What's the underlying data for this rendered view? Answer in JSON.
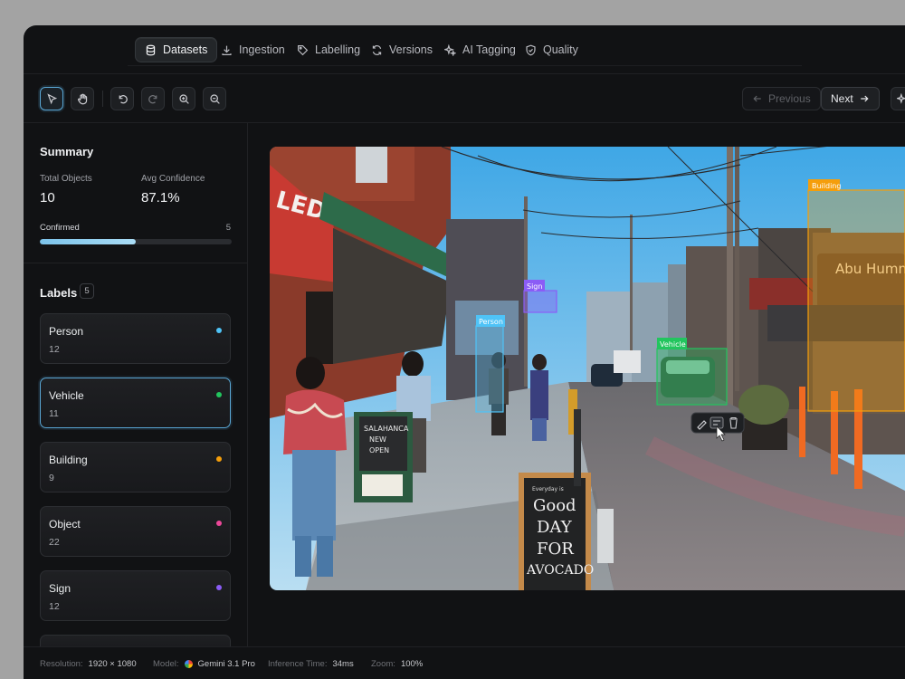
{
  "nav": {
    "tabs": [
      {
        "label": "Datasets",
        "icon": "database-icon",
        "active": true
      },
      {
        "label": "Ingestion",
        "icon": "download-icon"
      },
      {
        "label": "Labelling",
        "icon": "tag-icon"
      },
      {
        "label": "Versions",
        "icon": "refresh-icon"
      },
      {
        "label": "AI Tagging",
        "icon": "sparkle-icon"
      },
      {
        "label": "Quality",
        "icon": "shield-icon"
      }
    ]
  },
  "toolbar": {
    "previous_label": "Previous",
    "next_label": "Next"
  },
  "summary": {
    "title": "Summary",
    "total_objects_label": "Total Objects",
    "total_objects": "10",
    "avg_confidence_label": "Avg Confidence",
    "avg_confidence": "87.1%",
    "confirmed_label": "Confirmed",
    "confirmed_count": "5",
    "confirmed_fraction": 0.5
  },
  "labels": {
    "title": "Labels",
    "count": "5",
    "items": [
      {
        "name": "Person",
        "count": "12",
        "color": "#4fc3f7"
      },
      {
        "name": "Vehicle",
        "count": "11",
        "color": "#22c55e",
        "selected": true
      },
      {
        "name": "Building",
        "count": "9",
        "color": "#f59e0b"
      },
      {
        "name": "Object",
        "count": "22",
        "color": "#ec4899"
      },
      {
        "name": "Sign",
        "count": "12",
        "color": "#8b5cf6"
      }
    ]
  },
  "annotations": {
    "person_tag": "Person",
    "sign_tag": "Sign",
    "vehicle_tag": "Vehicle",
    "building_tag": "Building"
  },
  "signs": {
    "shop_board": [
      "SALAHANCA",
      "NEW",
      "OPEN"
    ],
    "chalkboard": [
      "Everyday is",
      "Good",
      "DAY",
      "FOR",
      "AVOCADO"
    ],
    "storefront": "Abu Hummus",
    "awning": "LED"
  },
  "statusbar": {
    "resolution_label": "Resolution:",
    "resolution": "1920 × 1080",
    "model_label": "Model:",
    "model": "Gemini 3.1 Pro",
    "inference_label": "Inference Time:",
    "inference": "34ms",
    "zoom_label": "Zoom:",
    "zoom": "100%"
  },
  "colors": {
    "accent": "#5aa8d6",
    "person": "#4fc3f7",
    "vehicle": "#22c55e",
    "building": "#f59e0b",
    "object": "#ec4899",
    "sign": "#8b5cf6"
  }
}
